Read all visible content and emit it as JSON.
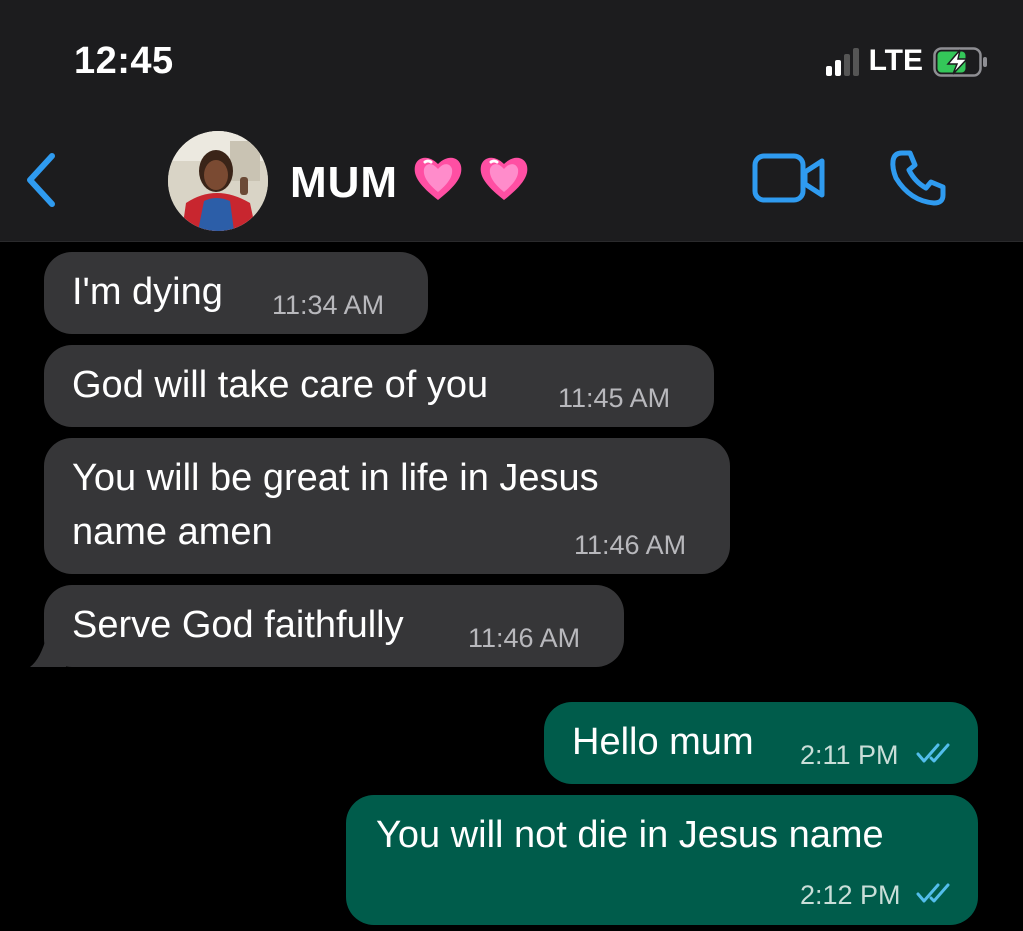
{
  "status_bar": {
    "time": "12:45",
    "network": "LTE",
    "battery_state": "charging"
  },
  "header": {
    "contact_name": "MUM",
    "name_emoji": "💗💗",
    "back_icon": "chevron-left-icon",
    "video_icon": "video-camera-icon",
    "call_icon": "phone-icon"
  },
  "messages": [
    {
      "direction": "incoming",
      "text": "I'm dying",
      "time": "11:34 AM"
    },
    {
      "direction": "incoming",
      "text": "God will take care of you",
      "time": "11:45 AM"
    },
    {
      "direction": "incoming",
      "text_line1": "You will be great in life in Jesus",
      "text_line2": "name amen",
      "time": "11:46 AM"
    },
    {
      "direction": "incoming",
      "text": "Serve God faithfully",
      "time": "11:46 AM"
    },
    {
      "direction": "outgoing",
      "text": "Hello mum",
      "time": "2:11 PM",
      "status": "read"
    },
    {
      "direction": "outgoing",
      "text": "You will not die in Jesus name",
      "time": "2:12 PM",
      "status": "read"
    }
  ],
  "colors": {
    "accent": "#2f9bf0",
    "incoming_bubble": "#363638",
    "outgoing_bubble": "#005c4b",
    "header_bg": "#1c1c1e",
    "read_ticks": "#53bdeb",
    "battery_charging": "#34c759"
  }
}
